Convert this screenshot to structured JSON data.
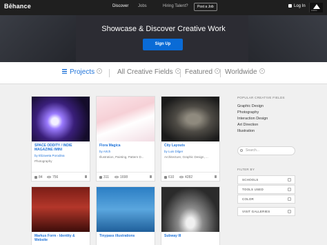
{
  "topbar": {
    "logo": "Bēhance",
    "nav": [
      "Discover",
      "Jobs",
      "Hiring Talent?"
    ],
    "post_job": "Post a Job",
    "login": "Log In",
    "adobe": "Adobe"
  },
  "hero": {
    "title": "Showcase & Discover Creative Work",
    "signup": "Sign Up"
  },
  "filters": {
    "projects": "Projects",
    "fields": "All Creative Fields",
    "featured": "Featured",
    "worldwide": "Worldwide"
  },
  "cards": [
    {
      "title": "SPACE ODDITY / INDIE MAGAZINE /MINI",
      "by": "by",
      "author": "Elizaveta Porodina",
      "tags": "Photography",
      "likes": "84",
      "views": "756"
    },
    {
      "title": "Flora Magica",
      "by": "by",
      "author": "Artch",
      "tags": "Illustration, Painting, Pattern D...",
      "likes": "311",
      "views": "1698"
    },
    {
      "title": "City Layouts",
      "by": "by",
      "author": "Luis Dilger",
      "tags": "Architecture, Graphic Design, ...",
      "likes": "610",
      "views": "4282"
    },
    {
      "title": "Markus Form - Identity & Website"
    },
    {
      "title": "Tinypass illustrations"
    },
    {
      "title": "Subway III"
    }
  ],
  "sidebar": {
    "popular_head": "POPULAR CREATIVE FIELDS",
    "popular": [
      "Graphic Design",
      "Photography",
      "Interaction Design",
      "Art Direction",
      "Illustration"
    ],
    "search_placeholder": "Search...",
    "filter_head": "FILTER BY",
    "filter_buttons": [
      "SCHOOLS",
      "TOOLS USED",
      "COLOR",
      "VISIT GALLERIES"
    ]
  },
  "colors": {
    "accent": "#1f73d9",
    "signup": "#0a6bd6",
    "topbar": "#1f1f1f"
  }
}
